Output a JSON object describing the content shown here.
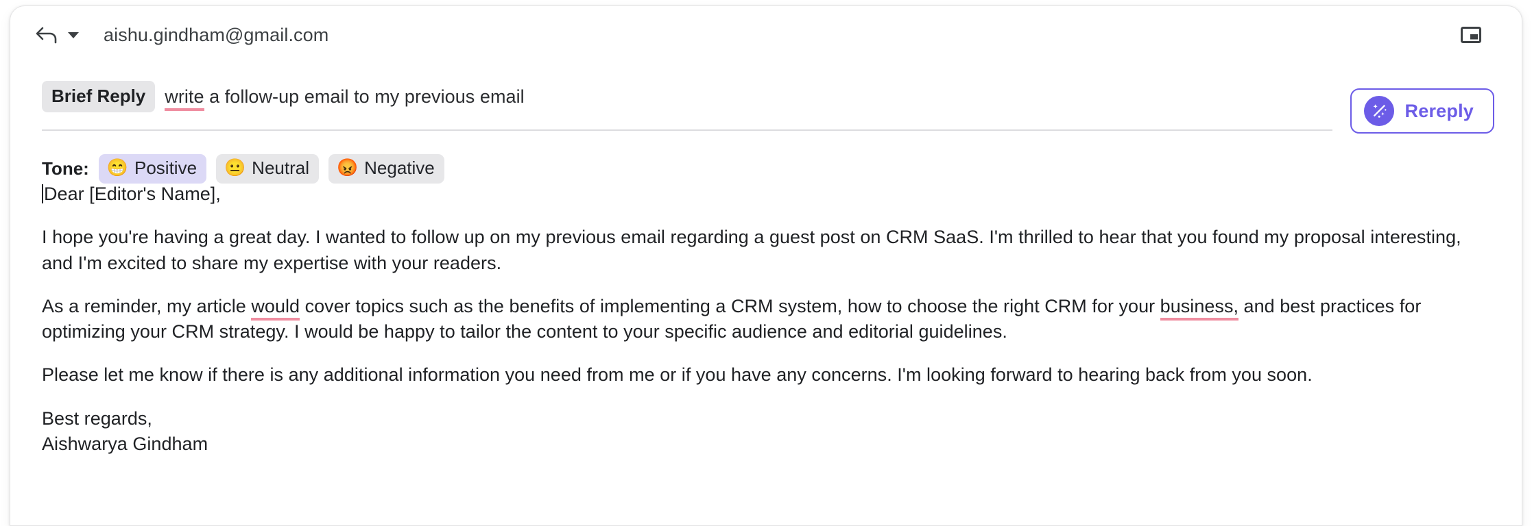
{
  "header": {
    "reply_icon": "reply-arrow-icon",
    "dropdown_icon": "chevron-down-icon",
    "recipient": "aishu.gindham@gmail.com",
    "popout_icon": "popout-window-icon"
  },
  "prompt": {
    "mode_chip": "Brief Reply",
    "text_misspelled": "write",
    "text_rest": " a follow-up email to my previous email",
    "spellcheck_color": "#ef8da0"
  },
  "rereply": {
    "label": "Rereply",
    "icon": "magic-wand-icon",
    "accent_color": "#6c5ce7"
  },
  "tone": {
    "label": "Tone:",
    "selected": "Positive",
    "options": [
      {
        "label": "Positive",
        "emoji": "😁",
        "selected": true
      },
      {
        "label": "Neutral",
        "emoji": "😐",
        "selected": false
      },
      {
        "label": "Negative",
        "emoji": "😡",
        "selected": false
      }
    ],
    "selected_bg": "#dcd9f6",
    "unselected_bg": "#e7e7e9"
  },
  "body": {
    "salutation": "Dear [Editor's Name],",
    "paragraph_1": "I hope you're having a great day. I wanted to follow up on my previous email regarding a guest post on CRM SaaS. I'm thrilled to hear that you found my proposal interesting, and I'm excited to share my expertise with your readers.",
    "paragraph_2_a": "As a reminder, my article ",
    "paragraph_2_mis1": "would",
    "paragraph_2_b": " cover topics such as the benefits of implementing a CRM system, how to choose the right CRM for your ",
    "paragraph_2_mis2": "business,",
    "paragraph_2_c": " and best practices for optimizing your CRM strategy. I would be happy to tailor the content to your specific audience and editorial guidelines.",
    "paragraph_3": "Please let me know if there is any additional information you need from me or if you have any concerns. I'm looking forward to hearing back from you soon.",
    "signoff": "Best regards,",
    "sender_name": "Aishwarya Gindham"
  }
}
